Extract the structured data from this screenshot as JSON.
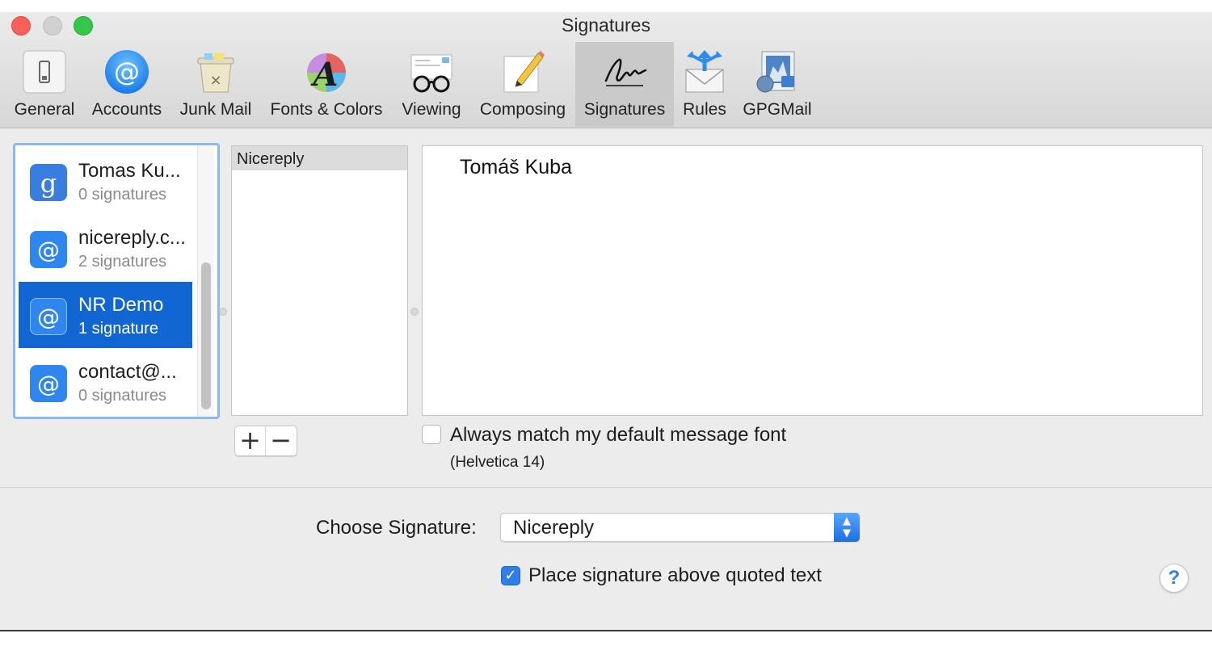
{
  "window": {
    "title": "Signatures"
  },
  "toolbar": {
    "items": [
      {
        "label": "General",
        "icon": "general-switch-icon"
      },
      {
        "label": "Accounts",
        "icon": "at-sign-icon"
      },
      {
        "label": "Junk Mail",
        "icon": "trash-bin-icon"
      },
      {
        "label": "Fonts & Colors",
        "icon": "font-palette-icon"
      },
      {
        "label": "Viewing",
        "icon": "glasses-icon"
      },
      {
        "label": "Composing",
        "icon": "pencil-paper-icon"
      },
      {
        "label": "Signatures",
        "icon": "signature-icon"
      },
      {
        "label": "Rules",
        "icon": "rules-envelope-icon"
      },
      {
        "label": "GPGMail",
        "icon": "gpgmail-icon"
      }
    ],
    "active": "Signatures"
  },
  "accounts": [
    {
      "name": "Tomas Ku...",
      "count": "0 signatures",
      "icon": "google-icon"
    },
    {
      "name": "nicereply.c...",
      "count": "2 signatures",
      "icon": "at-sign-icon"
    },
    {
      "name": "NR Demo",
      "count": "1 signature",
      "icon": "at-sign-icon",
      "selected": true
    },
    {
      "name": "contact@...",
      "count": "0 signatures",
      "icon": "at-sign-icon"
    }
  ],
  "signatures": [
    "Nicereply"
  ],
  "editor": {
    "text": "Tomáš Kuba"
  },
  "buttons": {
    "add": "+",
    "remove": "−"
  },
  "match_font": {
    "label": "Always match my default message font",
    "font": "(Helvetica 14)",
    "checked": false
  },
  "choose_signature": {
    "label": "Choose Signature:",
    "value": "Nicereply"
  },
  "place_above": {
    "label": "Place signature above quoted text",
    "checked": true
  },
  "help": {
    "label": "?"
  },
  "colors": {
    "selection": "#1266d4",
    "accent": "#2f7ee6",
    "close": "#fc5f57",
    "maximize": "#34c84a"
  }
}
